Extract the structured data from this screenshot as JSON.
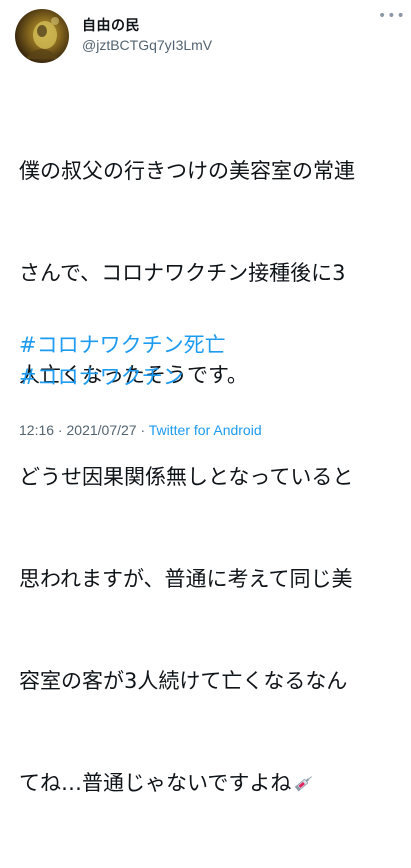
{
  "author": {
    "display_name": "自由の民",
    "handle": "@jztBCTGq7yI3LmV",
    "avatar_icon": "avatar-photo"
  },
  "more_menu": {
    "icon": "more-dots-icon",
    "glyph": "•••"
  },
  "tweet": {
    "lines": [
      "僕の叔父の行きつけの美容室の常連",
      "さんで、コロナワクチン接種後に3",
      "人亡くなったそうです。",
      "どうせ因果関係無しとなっていると",
      "思われますが、普通に考えて同じ美",
      "容室の客が3人続けて亡くなるなん",
      "てね…普通じゃないですよね"
    ],
    "emoji": "syringe-icon",
    "hashtags": [
      "#コロナワクチン死亡",
      "#コロナワクチン"
    ]
  },
  "meta": {
    "time": "12:16",
    "date": "2021/07/27",
    "separator": " · ",
    "source": "Twitter for Android"
  },
  "colors": {
    "text": "#0f1419",
    "secondary": "#536471",
    "link": "#1d9bf0"
  }
}
